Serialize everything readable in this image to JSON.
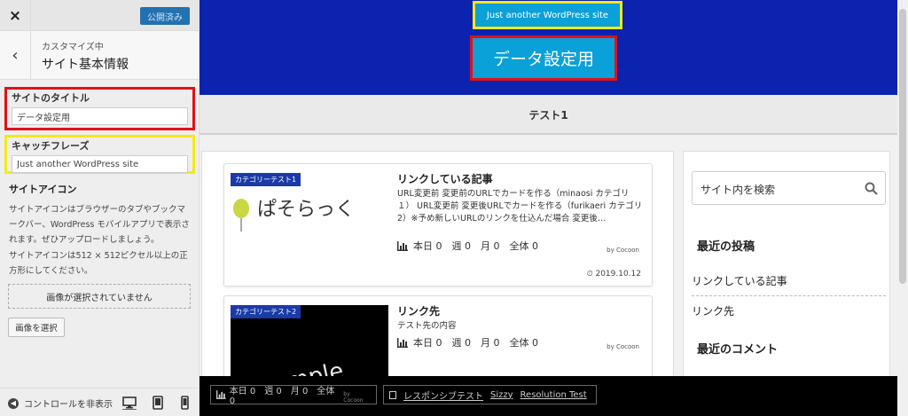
{
  "sidebar": {
    "close": "×",
    "publish_label": "公開済み",
    "back": "‹",
    "breadcrumb": "カスタマイズ中",
    "panel_title": "サイト基本情報",
    "site_title_label": "サイトのタイトル",
    "site_title_value": "データ設定用",
    "tagline_label": "キャッチフレーズ",
    "tagline_value": "Just another WordPress site",
    "site_icon_heading": "サイトアイコン",
    "site_icon_desc1": "サイトアイコンはブラウザーのタブやブックマークバー、WordPress モバイルアプリで表示されます。ぜひアップロードしましょう。",
    "site_icon_desc2": "サイトアイコンは512 × 512ピクセル以上の正方形にしてください。",
    "no_image": "画像が選択されていません",
    "select_image": "画像を選択",
    "collapse": "コントロールを非表示"
  },
  "preview": {
    "tagline": "Just another WordPress site",
    "site_title": "データ設定用",
    "nav_item": "テスト1",
    "cards": [
      {
        "category": "カテゴリーテスト1",
        "title": "リンクしている記事",
        "excerpt": "URL変更前 変更前のURLでカードを作る（minaosi カテゴリ１） URL変更前 変更後URLでカードを作る（furikaeri カテゴリ2）※予め新しいURLのリンクを仕込んだ場合 変更後…",
        "stats": "本日 0　週 0　月 0　全体 0",
        "by": "by Cocoon",
        "date": "2019.10.12",
        "thumb_text": "ぱそらっく"
      },
      {
        "category": "カテゴリーテスト2",
        "title": "リンク先",
        "excerpt": "テスト先の内容",
        "stats": "本日 0　週 0　月 0　全体 0",
        "by": "by Cocoon",
        "thumb_text": "Sample"
      }
    ],
    "search_placeholder": "サイト内を検索",
    "recent_posts_heading": "最近の投稿",
    "recent_posts": [
      "リンクしている記事",
      "リンク先"
    ],
    "recent_comments_heading": "最近のコメント",
    "admin_stats": "本日 0　週 0　月 0　全体 0",
    "admin_by": "by Cocoon",
    "admin_links": [
      "レスポンシブテスト",
      "Sizzy",
      "Resolution Test"
    ]
  },
  "colors": {
    "header_bg": "#0c23b0",
    "badge_bg": "#0aa0d8",
    "highlight_red": "#e0101a",
    "highlight_yellow": "#f2ea18"
  }
}
